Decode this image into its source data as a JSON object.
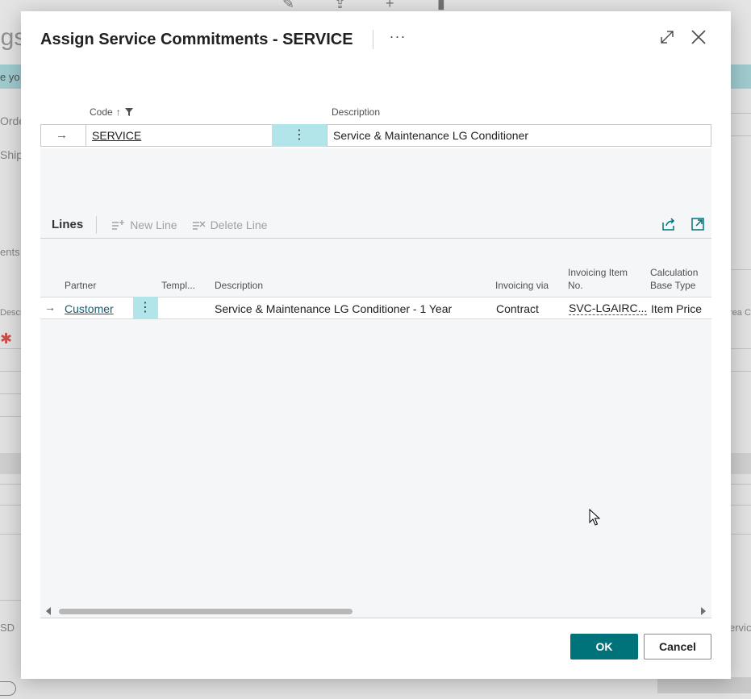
{
  "background": {
    "title_fragment": "ngs",
    "banner_fragment": "e yo",
    "fields": [
      "Orde",
      "Shipm",
      "ents",
      "Descr",
      "SD"
    ],
    "right_fragments": [
      "rea C",
      "ervic"
    ]
  },
  "dialog": {
    "title": "Assign Service Commitments - SERVICE",
    "more_label": "···",
    "expand_icon": "expand-icon",
    "close_icon": "close-icon"
  },
  "header_grid": {
    "columns": {
      "code": "Code",
      "description": "Description"
    },
    "sort_indicator": "↑",
    "row": {
      "code": "SERVICE",
      "description": "Service & Maintenance LG Conditioner"
    }
  },
  "lines": {
    "title": "Lines",
    "actions": {
      "new_line": "New Line",
      "delete_line": "Delete Line"
    },
    "columns": {
      "partner": "Partner",
      "template": "Templ...",
      "description": "Description",
      "invoicing_via": "Invoicing via",
      "invoicing_item_no_1": "Invoicing Item",
      "invoicing_item_no_2": "No.",
      "calc_base_type_1": "Calculation",
      "calc_base_type_2": "Base Type"
    },
    "rows": [
      {
        "partner": "Customer",
        "template": "",
        "description": "Service & Maintenance LG Conditioner - 1 Year",
        "invoicing_via": "Contract",
        "invoicing_item_no": "SVC-LGAIRC...",
        "calc_base_type": "Item Price"
      }
    ]
  },
  "buttons": {
    "ok": "OK",
    "cancel": "Cancel"
  },
  "colors": {
    "accent": "#00737a",
    "selection": "#b2e5ea",
    "link": "#1a5a6e"
  }
}
